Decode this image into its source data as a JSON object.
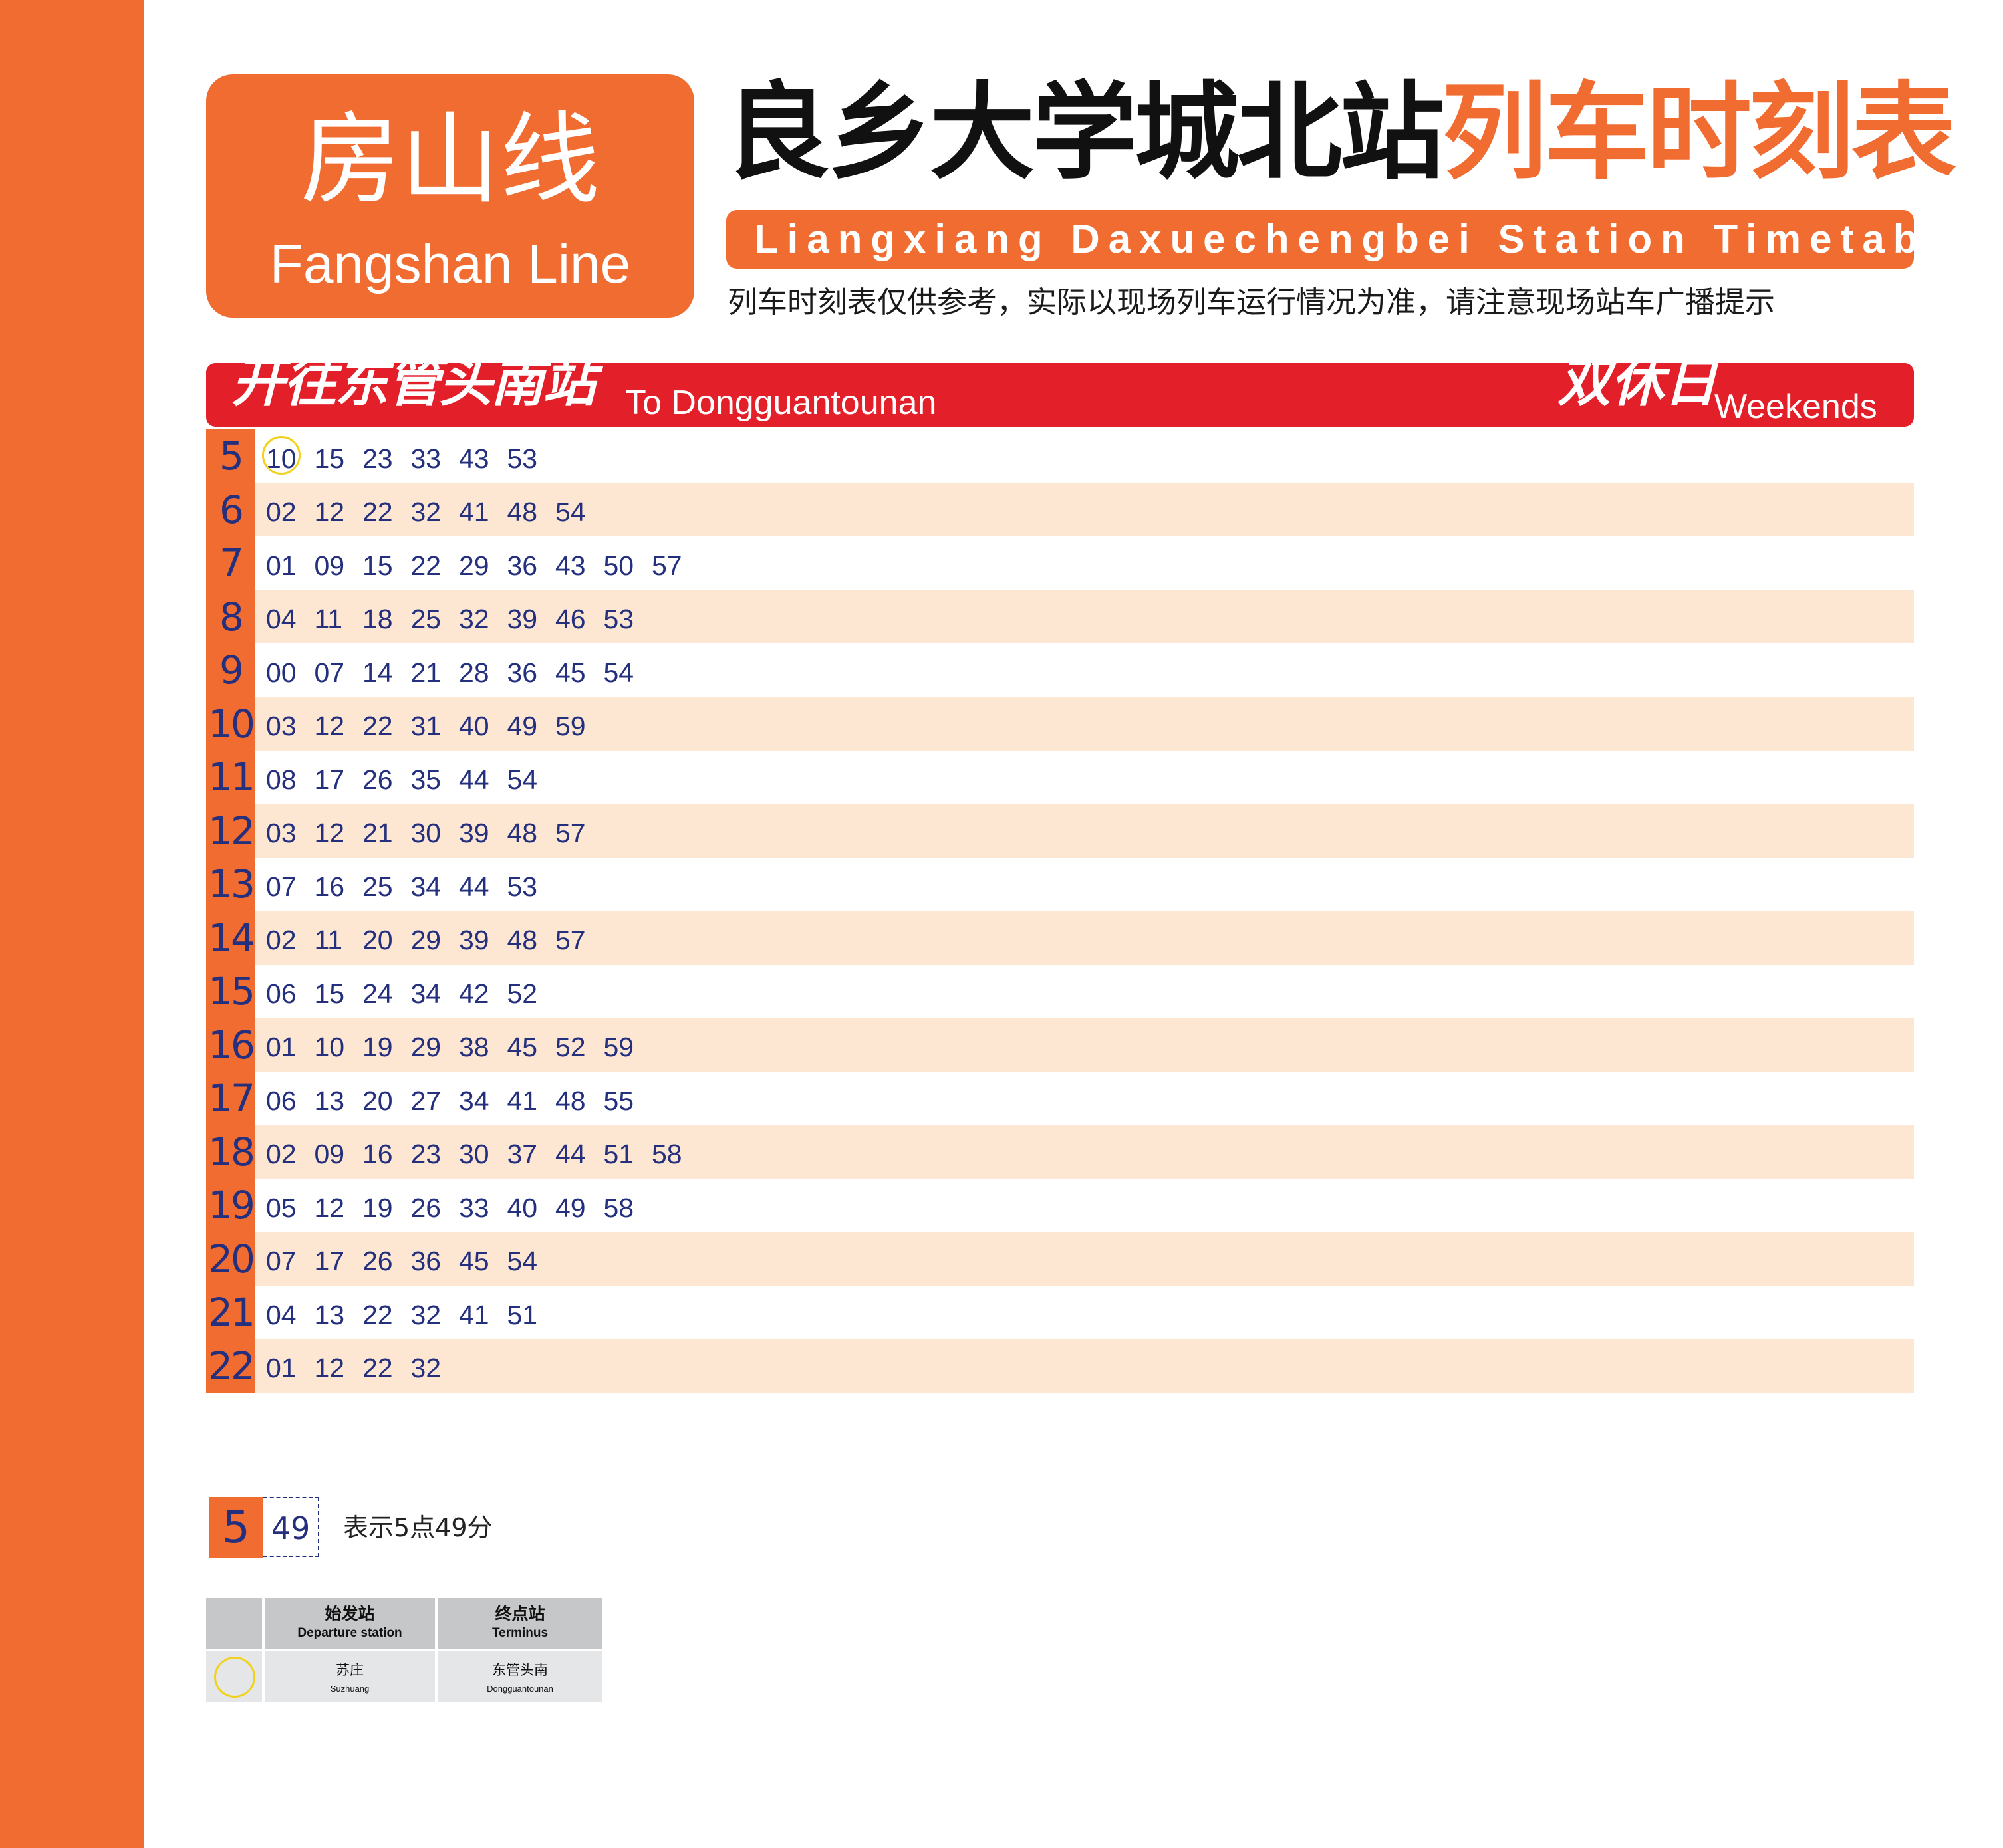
{
  "line": {
    "cn": "房山线",
    "en": "Fangshan Line"
  },
  "title": {
    "station": "良乡大学城北站",
    "suffix": "列车时刻表"
  },
  "subtitle_en": "Liangxiang Daxuechengbei Station Timetable",
  "notice": "列车时刻表仅供参考，实际以现场列车运行情况为准，请注意现场站车广播提示",
  "direction": {
    "cn": "开往东管头南站",
    "en": "To Dongguantounan"
  },
  "day_type": {
    "cn": "双休日",
    "en": "Weekends"
  },
  "colors": {
    "accent": "#f16c31",
    "direction_bar": "#e3202a",
    "digits": "#24307e",
    "row_alt": "#fde6d2",
    "origin_marker": "#f2d11a"
  },
  "timetable": [
    {
      "hour": "5",
      "minutes": [
        "10",
        "15",
        "23",
        "33",
        "43",
        "53"
      ]
    },
    {
      "hour": "6",
      "minutes": [
        "02",
        "12",
        "22",
        "32",
        "41",
        "48",
        "54"
      ]
    },
    {
      "hour": "7",
      "minutes": [
        "01",
        "09",
        "15",
        "22",
        "29",
        "36",
        "43",
        "50",
        "57"
      ]
    },
    {
      "hour": "8",
      "minutes": [
        "04",
        "11",
        "18",
        "25",
        "32",
        "39",
        "46",
        "53"
      ]
    },
    {
      "hour": "9",
      "minutes": [
        "00",
        "07",
        "14",
        "21",
        "28",
        "36",
        "45",
        "54"
      ]
    },
    {
      "hour": "10",
      "minutes": [
        "03",
        "12",
        "22",
        "31",
        "40",
        "49",
        "59"
      ]
    },
    {
      "hour": "11",
      "minutes": [
        "08",
        "17",
        "26",
        "35",
        "44",
        "54"
      ]
    },
    {
      "hour": "12",
      "minutes": [
        "03",
        "12",
        "21",
        "30",
        "39",
        "48",
        "57"
      ]
    },
    {
      "hour": "13",
      "minutes": [
        "07",
        "16",
        "25",
        "34",
        "44",
        "53"
      ]
    },
    {
      "hour": "14",
      "minutes": [
        "02",
        "11",
        "20",
        "29",
        "39",
        "48",
        "57"
      ]
    },
    {
      "hour": "15",
      "minutes": [
        "06",
        "15",
        "24",
        "34",
        "42",
        "52"
      ]
    },
    {
      "hour": "16",
      "minutes": [
        "01",
        "10",
        "19",
        "29",
        "38",
        "45",
        "52",
        "59"
      ]
    },
    {
      "hour": "17",
      "minutes": [
        "06",
        "13",
        "20",
        "27",
        "34",
        "41",
        "48",
        "55"
      ]
    },
    {
      "hour": "18",
      "minutes": [
        "02",
        "09",
        "16",
        "23",
        "30",
        "37",
        "44",
        "51",
        "58"
      ]
    },
    {
      "hour": "19",
      "minutes": [
        "05",
        "12",
        "19",
        "26",
        "33",
        "40",
        "49",
        "58"
      ]
    },
    {
      "hour": "20",
      "minutes": [
        "07",
        "17",
        "26",
        "36",
        "45",
        "54"
      ]
    },
    {
      "hour": "21",
      "minutes": [
        "04",
        "13",
        "22",
        "32",
        "41",
        "51"
      ]
    },
    {
      "hour": "22",
      "minutes": [
        "01",
        "12",
        "22",
        "32"
      ]
    }
  ],
  "legend": {
    "hour": "5",
    "minute": "49",
    "text": "表示5点49分"
  },
  "stations": {
    "headers": [
      {
        "cn": "始发站",
        "en": "Departure station"
      },
      {
        "cn": "终点站",
        "en": "Terminus"
      }
    ],
    "row": [
      {
        "cn": "苏庄",
        "en": "Suzhuang"
      },
      {
        "cn": "东管头南",
        "en": "Dongguantounan"
      }
    ]
  }
}
